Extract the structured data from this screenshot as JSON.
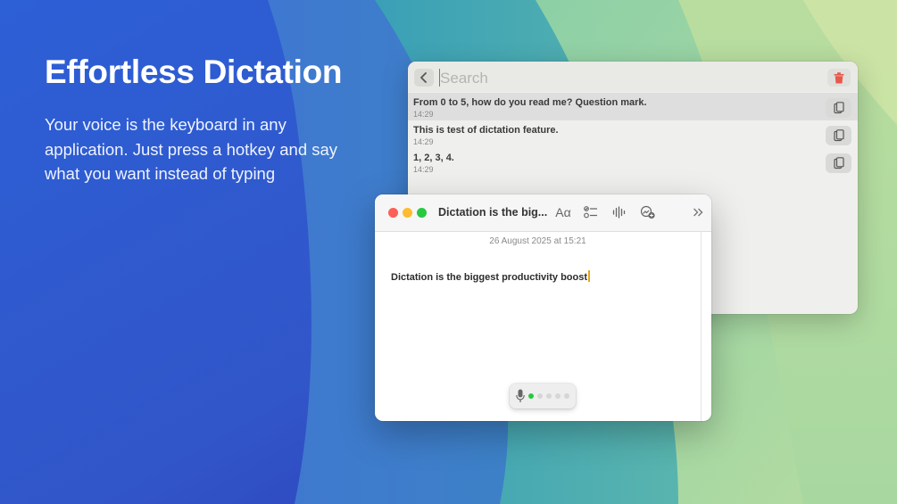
{
  "hero": {
    "title": "Effortless Dictation",
    "description": "Your voice is the keyboard in any application. Just press a hotkey and say what you want instead of typing"
  },
  "history": {
    "search_placeholder": "Search",
    "items": [
      {
        "text": "From 0 to 5, how do you read me? Question mark.",
        "time": "14:29",
        "selected": true
      },
      {
        "text": "This is test of dictation feature.",
        "time": "14:29",
        "selected": false
      },
      {
        "text": "1, 2, 3, 4.",
        "time": "14:29",
        "selected": false
      }
    ],
    "icons": {
      "back": "chevron-left-icon",
      "delete": "trash-icon",
      "copy": "clipboard-icon"
    },
    "colors": {
      "trash": "#e8584b"
    }
  },
  "notes": {
    "title": "Dictation is the big...",
    "format_label": "Aα",
    "date": "26 August 2025 at 15:21",
    "body": "Dictation is the biggest productivity boost",
    "icons": [
      "checklist-icon",
      "audio-waveform-icon",
      "collaborate-icon",
      "more-chevrons-icon"
    ],
    "mic_level": 0.2,
    "colors": {
      "close": "#fe5f57",
      "minimize": "#febc2e",
      "zoom": "#28c840",
      "level_active": "#28c840",
      "cursor": "#e8a31a"
    }
  }
}
